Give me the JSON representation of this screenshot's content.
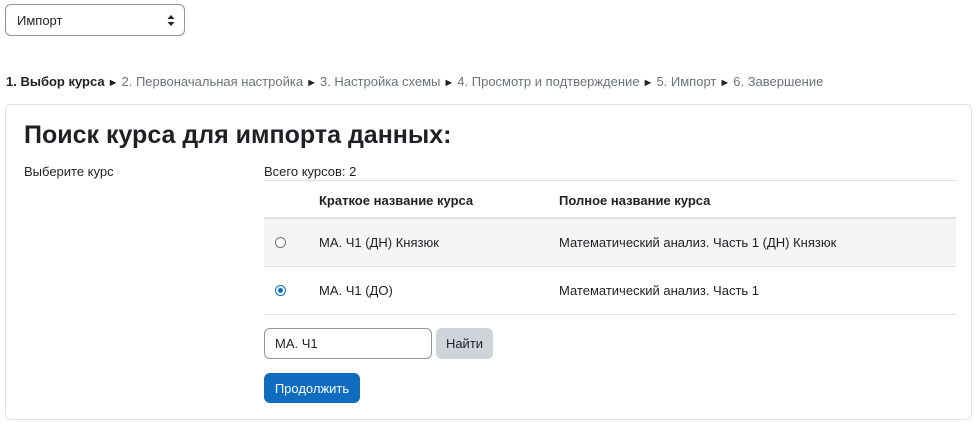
{
  "import_select": {
    "selected": "Импорт"
  },
  "steps": [
    {
      "label": "1. Выбор курса",
      "current": true
    },
    {
      "label": "2. Первоначальная настройка",
      "current": false
    },
    {
      "label": "3. Настройка схемы",
      "current": false
    },
    {
      "label": "4. Просмотр и подтверждение",
      "current": false
    },
    {
      "label": "5. Импорт",
      "current": false
    },
    {
      "label": "6. Завершение",
      "current": false
    }
  ],
  "step_separator": "►",
  "main": {
    "heading": "Поиск курса для импорта данных:",
    "field_label": "Выберите курс",
    "total_courses": "Всего курсов: 2"
  },
  "table": {
    "headers": {
      "short": "Краткое название курса",
      "full": "Полное название курса"
    },
    "rows": [
      {
        "selected": false,
        "short": "МА. Ч1 (ДН) Князюк",
        "full": "Математический анализ. Часть 1 (ДН) Князюк"
      },
      {
        "selected": true,
        "short": "МА. Ч1 (ДО)",
        "full": "Математический анализ. Часть 1"
      }
    ]
  },
  "search": {
    "value": "МА. Ч1",
    "button": "Найти"
  },
  "continue_button": "Продолжить",
  "colors": {
    "primary": "#0f6cbf",
    "secondary_button": "#ced4da",
    "muted_text": "#6a737b"
  }
}
